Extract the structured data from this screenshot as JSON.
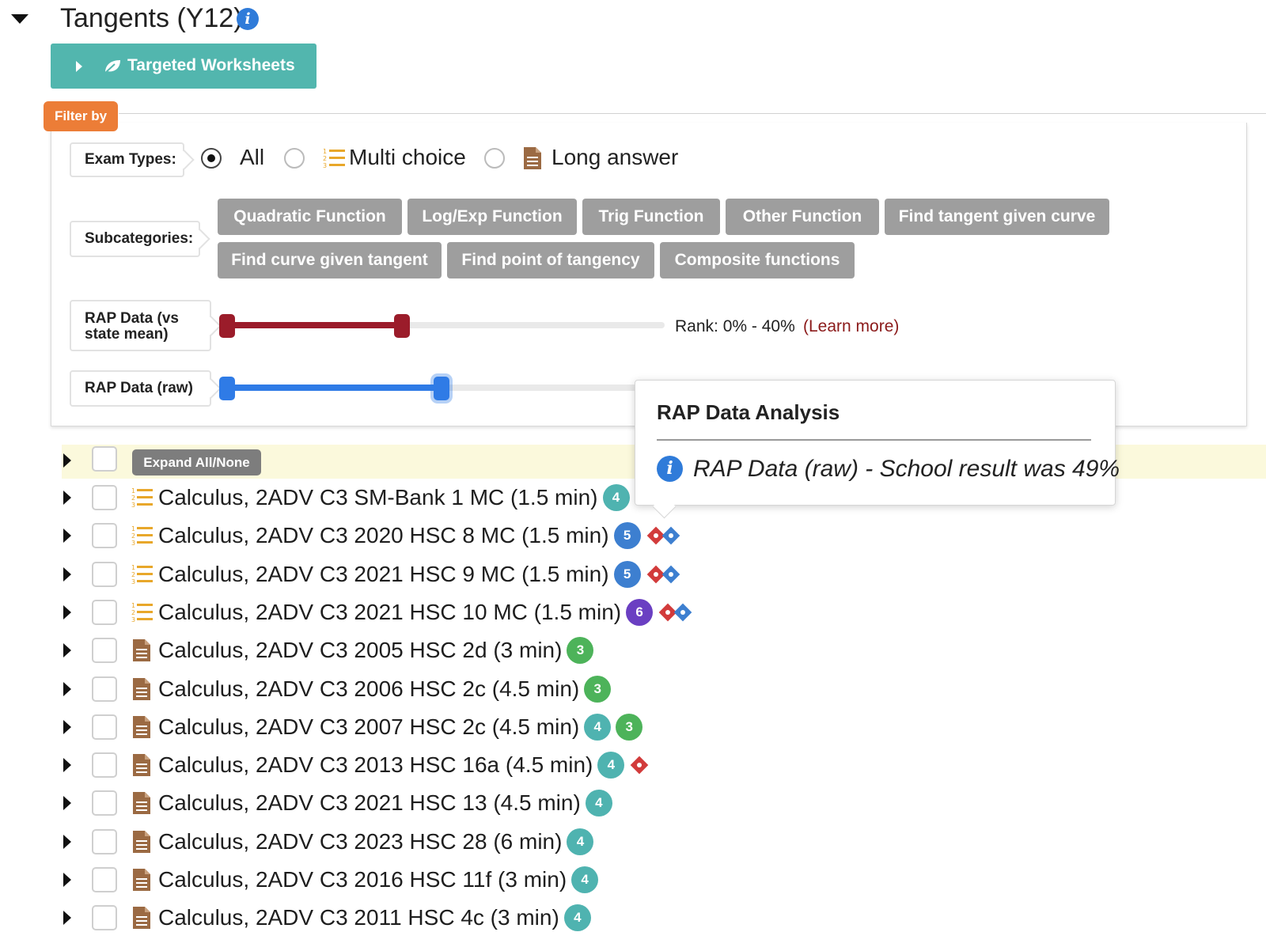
{
  "header": {
    "title": "Tangents (Y12)",
    "info_icon": "info-circle-icon"
  },
  "targeted_worksheets": {
    "label": "Targeted Worksheets",
    "icon": "leaf-icon",
    "color": "#52b6ae"
  },
  "filter": {
    "tag_label": "Filter by",
    "tag_color": "#ec7d37",
    "exam_types": {
      "label": "Exam Types:",
      "options": [
        {
          "label": "All",
          "selected": true,
          "icon": ""
        },
        {
          "label": "Multi choice",
          "selected": false,
          "icon": "numbered-list-icon"
        },
        {
          "label": "Long answer",
          "selected": false,
          "icon": "document-icon"
        }
      ]
    },
    "subcategories": {
      "label": "Subcategories:",
      "items": [
        "Quadratic Function",
        "Log/Exp Function",
        "Trig Function",
        "Other Function",
        "Find tangent given curve",
        "Find curve given tangent",
        "Find point of tangency",
        "Composite functions"
      ]
    },
    "rap_vs_mean": {
      "label": "RAP Data (vs state mean)",
      "rank_text": "Rank: 0% - 40%",
      "learn_more": "(Learn more)",
      "range_min_pct": 0,
      "range_max_pct": 40,
      "color": "#9b1c2a"
    },
    "rap_raw": {
      "label": "RAP Data (raw)",
      "range_min_pct": 0,
      "range_max_pct": 49,
      "color": "#2f7be6"
    }
  },
  "tooltip": {
    "title": "RAP Data Analysis",
    "text": "RAP Data (raw) - School result was 49%",
    "icon": "info-circle-icon"
  },
  "list": {
    "expand_label": "Expand All/None",
    "colors": {
      "teal": "#4fb3b0",
      "blue": "#3d7fd0",
      "purple": "#6a3fc2",
      "green": "#4db35a",
      "red": "#d23b3b",
      "diamond_blue": "#3d7fd0"
    },
    "items": [
      {
        "type": "mc",
        "title": "Calculus, 2ADV C3 SM-Bank 1 MC (1.5 min)",
        "badges": [
          {
            "n": "4",
            "color": "teal"
          }
        ],
        "diamonds": []
      },
      {
        "type": "mc",
        "title": "Calculus, 2ADV C3 2020 HSC 8 MC (1.5 min)",
        "badges": [
          {
            "n": "5",
            "color": "blue"
          }
        ],
        "diamonds": [
          "red",
          "blue"
        ]
      },
      {
        "type": "mc",
        "title": "Calculus, 2ADV C3 2021 HSC 9 MC (1.5 min)",
        "badges": [
          {
            "n": "5",
            "color": "blue"
          }
        ],
        "diamonds": [
          "red",
          "blue"
        ]
      },
      {
        "type": "mc",
        "title": "Calculus, 2ADV C3 2021 HSC 10 MC (1.5 min)",
        "badges": [
          {
            "n": "6",
            "color": "purple"
          }
        ],
        "diamonds": [
          "red",
          "blue"
        ]
      },
      {
        "type": "la",
        "title": "Calculus, 2ADV C3 2005 HSC 2d (3 min)",
        "badges": [
          {
            "n": "3",
            "color": "green"
          }
        ],
        "diamonds": []
      },
      {
        "type": "la",
        "title": "Calculus, 2ADV C3 2006 HSC 2c (4.5 min)",
        "badges": [
          {
            "n": "3",
            "color": "green"
          }
        ],
        "diamonds": []
      },
      {
        "type": "la",
        "title": "Calculus, 2ADV C3 2007 HSC 2c (4.5 min)",
        "badges": [
          {
            "n": "4",
            "color": "teal"
          },
          {
            "n": "3",
            "color": "green"
          }
        ],
        "diamonds": []
      },
      {
        "type": "la",
        "title": "Calculus, 2ADV C3 2013 HSC 16a (4.5 min)",
        "badges": [
          {
            "n": "4",
            "color": "teal"
          }
        ],
        "diamonds": [
          "red"
        ]
      },
      {
        "type": "la",
        "title": "Calculus, 2ADV C3 2021 HSC 13 (4.5 min)",
        "badges": [
          {
            "n": "4",
            "color": "teal"
          }
        ],
        "diamonds": []
      },
      {
        "type": "la",
        "title": "Calculus, 2ADV C3 2023 HSC 28 (6 min)",
        "badges": [
          {
            "n": "4",
            "color": "teal"
          }
        ],
        "diamonds": []
      },
      {
        "type": "la",
        "title": "Calculus, 2ADV C3 2016 HSC 11f (3 min)",
        "badges": [
          {
            "n": "4",
            "color": "teal"
          }
        ],
        "diamonds": []
      },
      {
        "type": "la",
        "title": "Calculus, 2ADV C3 2011 HSC 4c (3 min)",
        "badges": [
          {
            "n": "4",
            "color": "teal"
          }
        ],
        "diamonds": []
      }
    ]
  }
}
